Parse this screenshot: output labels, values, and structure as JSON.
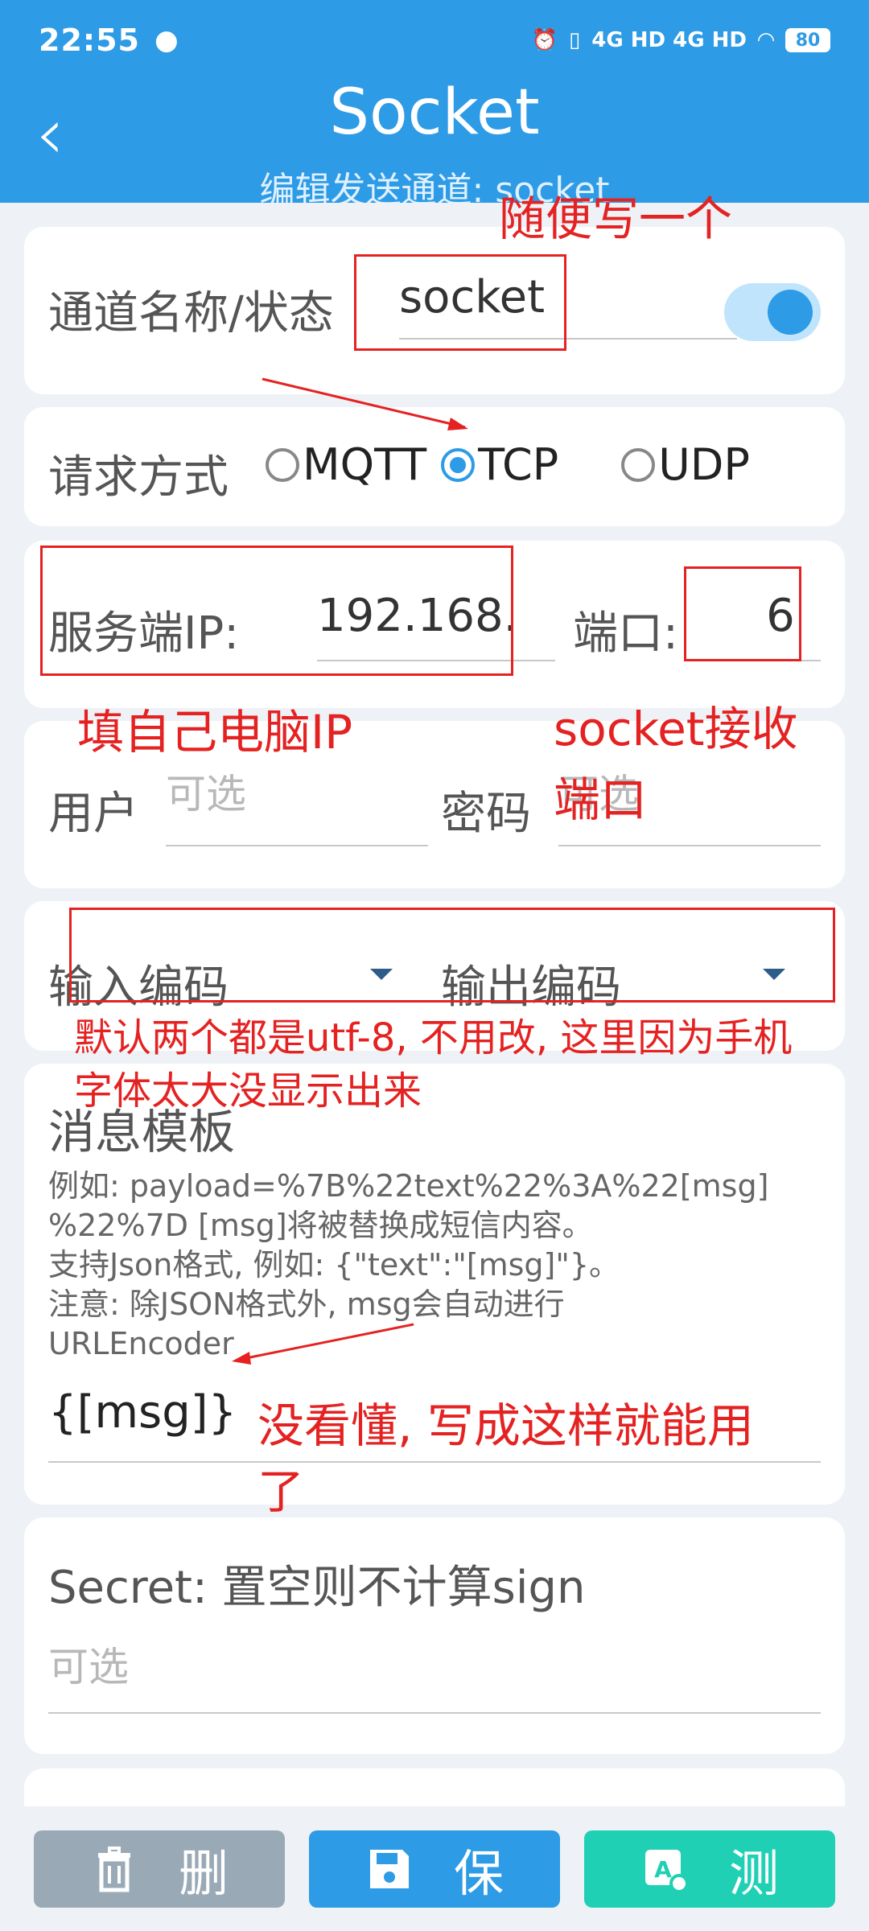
{
  "status": {
    "time": "22:55",
    "network": "4G HD 4G HD",
    "battery": "80"
  },
  "header": {
    "title": "Socket",
    "subtitle": "编辑发送通道: socket"
  },
  "channel": {
    "label": "通道名称/状态",
    "value": "socket",
    "enabled": true
  },
  "method": {
    "label": "请求方式",
    "options": [
      "MQTT",
      "TCP",
      "UDP"
    ],
    "selected": "TCP"
  },
  "server": {
    "ip_label": "服务端IP:",
    "ip_value": "192.168.",
    "port_label": "端口:",
    "port_value": "6"
  },
  "auth": {
    "user_label": "用户",
    "user_placeholder": "可选",
    "password_label": "密码",
    "password_placeholder": "可选"
  },
  "encoding": {
    "input_label": "输入编码",
    "output_label": "输出编码"
  },
  "template": {
    "title": "消息模板",
    "hint_lines": [
      "例如: payload=%7B%22text%22%3A%22[msg]",
      "%22%7D [msg]将被替换成短信内容。",
      "支持Json格式, 例如: {\"text\":\"[msg]\"}。",
      "注意: 除JSON格式外, msg会自动进行",
      "URLEncoder"
    ],
    "value": "{[msg]}"
  },
  "secret": {
    "label": "Secret: 置空则不计算sign",
    "placeholder": "可选"
  },
  "buttons": {
    "delete": "删",
    "save": "保",
    "test": "测"
  },
  "annotations": {
    "name_note": "随便写一个",
    "ip_note": "填自己电脑IP",
    "port_note_1": "socket接收",
    "port_note_2": "端口",
    "encoding_note_1": "默认两个都是utf-8, 不用改, 这里因为手机",
    "encoding_note_2": "字体太大没显示出来",
    "template_note_1": "没看懂, 写成这样就能用",
    "template_note_2": "了"
  },
  "colors": {
    "primary": "#2d9be5",
    "annotation": "#e52222",
    "test": "#20d0b5",
    "delete": "#9aa9b6"
  }
}
